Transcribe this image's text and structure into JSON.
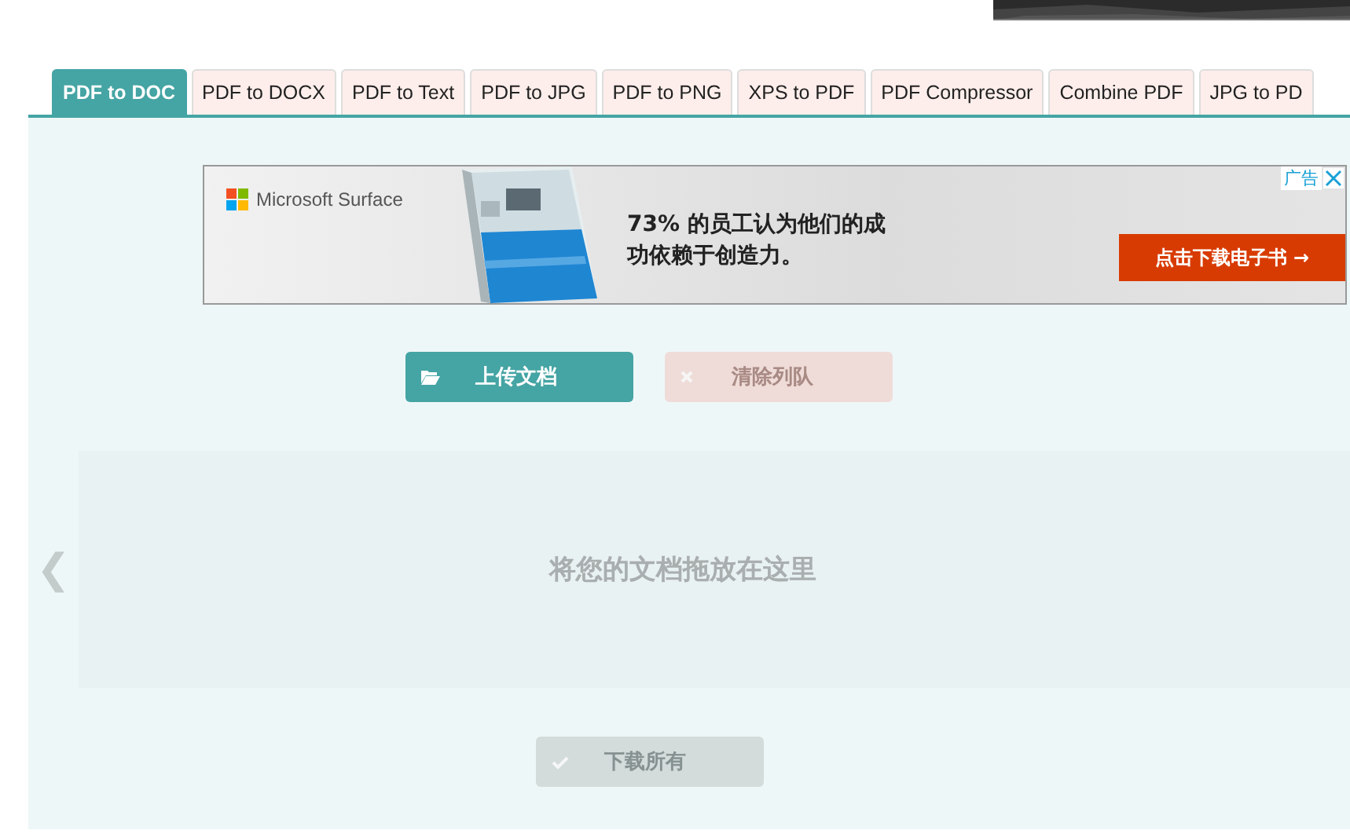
{
  "tabs": [
    {
      "label": "PDF to DOC",
      "selected": true
    },
    {
      "label": "PDF to DOCX",
      "selected": false
    },
    {
      "label": "PDF to Text",
      "selected": false
    },
    {
      "label": "PDF to JPG",
      "selected": false
    },
    {
      "label": "PDF to PNG",
      "selected": false
    },
    {
      "label": "XPS to PDF",
      "selected": false
    },
    {
      "label": "PDF Compressor",
      "selected": false
    },
    {
      "label": "Combine PDF",
      "selected": false
    },
    {
      "label": "JPG to PD",
      "selected": false
    }
  ],
  "ad": {
    "brand": "Microsoft Surface",
    "headline": "73% 的员工认为他们的成功依赖于创造力。",
    "cta": "点击下载电子书 →",
    "badge": "广告"
  },
  "actions": [
    {
      "kind": "upload",
      "label": "上传文档",
      "disabled": false
    },
    {
      "kind": "clear",
      "label": "清除列队",
      "disabled": true
    }
  ],
  "drop_zone": {
    "prev": "❮",
    "text": "将您的文档拖放在这里"
  },
  "download": {
    "label": "下载所有",
    "disabled": true
  }
}
